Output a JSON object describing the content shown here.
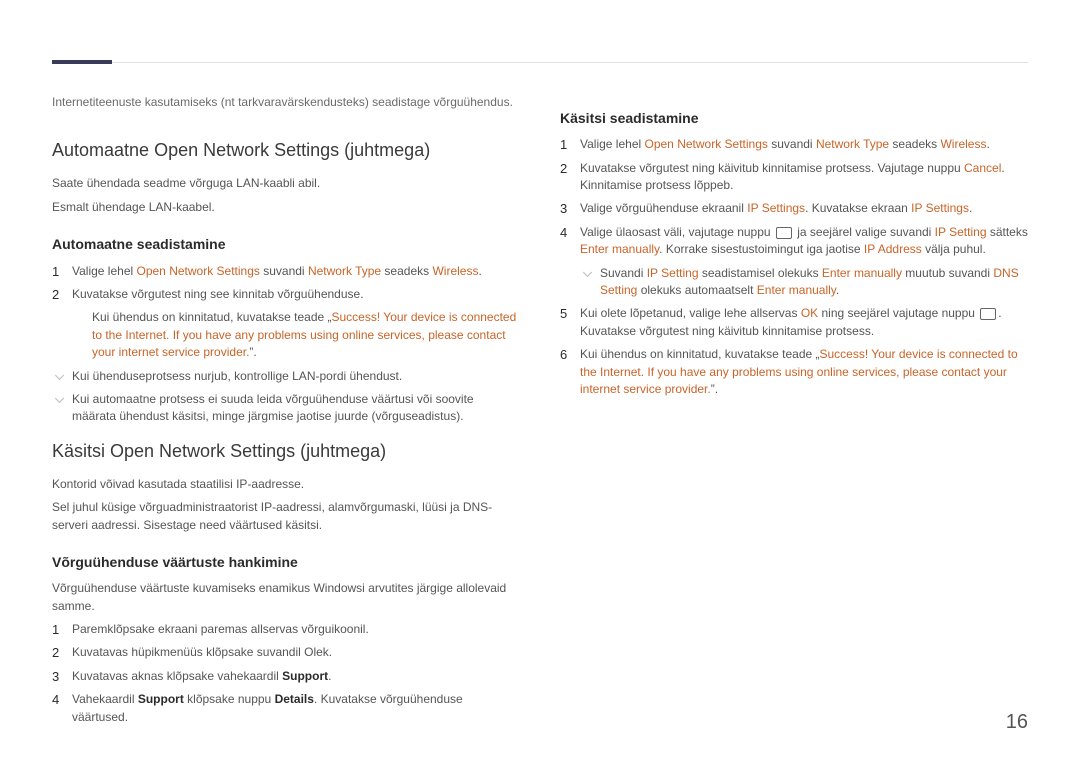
{
  "pageNumber": "16",
  "left": {
    "intro": "Internetiteenuste kasutamiseks (nt tarkvaravärskendusteks) seadistage võrguühendus.",
    "h2a": "Automaatne Open Network Settings (juhtmega)",
    "p1": "Saate ühendada seadme võrguga LAN-kaabli abil.",
    "p2": "Esmalt ühendage LAN-kaabel.",
    "h3a": "Automaatne seadistamine",
    "s1a_pre": "Valige lehel ",
    "s1a_l1": "Open Network Settings",
    "s1a_mid": " suvandi ",
    "s1a_l2": "Network Type",
    "s1a_mid2": " seadeks ",
    "s1a_l3": "Wireless",
    "s1a_end": ".",
    "s2a": "Kuvatakse võrgutest ning see kinnitab võrguühenduse.",
    "s2a_sub_pre": "Kui ühendus on kinnitatud, kuvatakse teade „",
    "s2a_sub_em": "Success! Your device is connected to the Internet. If you have any problems using online services, please contact your internet service provider.",
    "s2a_sub_end": "”.",
    "note1": "Kui ühenduseprotsess nurjub, kontrollige LAN-pordi ühendust.",
    "note2": "Kui automaatne protsess ei suuda leida võrguühenduse väärtusi või soovite määrata ühendust käsitsi, minge järgmise jaotise juurde (võrguseadistus).",
    "h2b": "Käsitsi Open Network Settings (juhtmega)",
    "p3": "Kontorid võivad kasutada staatilisi IP-aadresse.",
    "p4": "Sel juhul küsige võrguadministraatorist IP-aadressi, alamvõrgumaski, lüüsi ja DNS-serveri aadressi. Sisestage need väärtused käsitsi.",
    "h3b": "Võrguühenduse väärtuste hankimine",
    "p5": "Võrguühenduse väärtuste kuvamiseks enamikus Windowsi arvutites järgige allolevaid samme.",
    "s1b": "Paremklõpsake ekraani paremas allservas võrguikoonil.",
    "s2b": "Kuvatavas hüpikmenüüs klõpsake suvandil Olek.",
    "s3b_pre": "Kuvatavas aknas klõpsake vahekaardil ",
    "s3b_bold": "Support",
    "s3b_end": ".",
    "s4b_pre": "Vahekaardil ",
    "s4b_b1": "Support",
    "s4b_mid": " klõpsake nuppu ",
    "s4b_b2": "Details",
    "s4b_end": ". Kuvatakse võrguühenduse väärtused."
  },
  "right": {
    "h3": "Käsitsi seadistamine",
    "s1_pre": "Valige lehel ",
    "s1_l1": "Open Network Settings",
    "s1_mid": " suvandi ",
    "s1_l2": "Network Type",
    "s1_mid2": " seadeks ",
    "s1_l3": "Wireless",
    "s1_end": ".",
    "s2_pre": "Kuvatakse võrgutest ning käivitub kinnitamise protsess. Vajutage nuppu ",
    "s2_l": "Cancel",
    "s2_end": ". Kinnitamise protsess lõppeb.",
    "s3_pre": "Valige võrguühenduse ekraanil ",
    "s3_l1": "IP Settings",
    "s3_mid": ". Kuvatakse ekraan ",
    "s3_l2": "IP Settings",
    "s3_end": ".",
    "s4_pre": "Valige ülaosast väli, vajutage nuppu ",
    "s4_mid": " ja seejärel valige suvandi ",
    "s4_l1": "IP Setting",
    "s4_mid2": " sätteks ",
    "s4_l2": "Enter manually",
    "s4_mid3": ". Korrake sisestustoimingut iga jaotise ",
    "s4_l3": "IP Address",
    "s4_end": " välja puhul.",
    "note_pre": "Suvandi ",
    "note_l1": "IP Setting",
    "note_mid": " seadistamisel olekuks ",
    "note_l2": "Enter manually",
    "note_mid2": " muutub suvandi ",
    "note_l3": "DNS Setting",
    "note_mid3": " olekuks automaatselt ",
    "note_l4": "Enter manually",
    "note_end": ".",
    "s5_pre": "Kui olete lõpetanud, valige lehe allservas ",
    "s5_l": "OK",
    "s5_mid": " ning seejärel vajutage nuppu ",
    "s5_end": ". Kuvatakse võrgutest ning käivitub kinnitamise protsess.",
    "s6_pre": "Kui ühendus on kinnitatud, kuvatakse teade „",
    "s6_em": "Success! Your device is connected to the Internet. If you have any problems using online services, please contact your internet service provider.",
    "s6_end": "”."
  }
}
